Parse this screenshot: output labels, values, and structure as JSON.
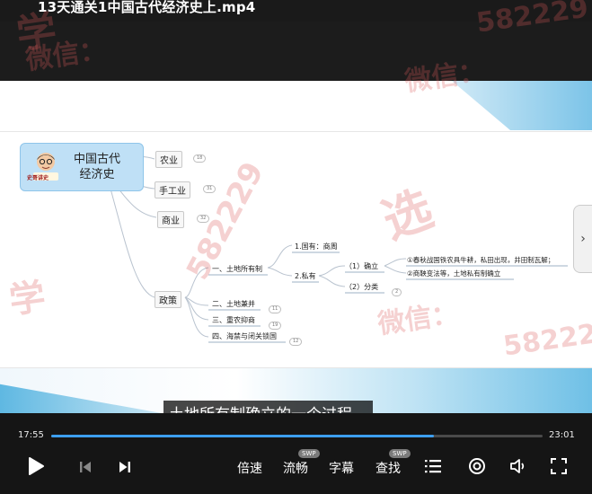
{
  "window": {
    "title": "13天通关1中国古代经济史上.mp4"
  },
  "mindmap": {
    "root": {
      "line1": "中国古代",
      "line2": "经济史",
      "avatar_caption": "史哥讲史"
    },
    "branches": [
      {
        "label": "农业",
        "badge": "18"
      },
      {
        "label": "手工业",
        "badge": "31"
      },
      {
        "label": "商业",
        "badge": "32"
      },
      {
        "label": "政策",
        "badge": ""
      }
    ],
    "policy_items": [
      {
        "label": "一、土地所有制"
      },
      {
        "label": "二、土地兼并",
        "badge": "11"
      },
      {
        "label": "三、重农抑商",
        "badge": "19"
      },
      {
        "label": "四、海禁与闭关锁国",
        "badge": "12"
      }
    ],
    "ownership": [
      {
        "label": "1.国有：商周"
      },
      {
        "label": "2.私有"
      }
    ],
    "private": [
      {
        "label": "（1）确立"
      },
      {
        "label": "（2）分类",
        "badge": "2"
      }
    ],
    "establish": [
      {
        "label": "①春秋战国铁农具牛耕，私田出现，井田制瓦解；"
      },
      {
        "label": "②商鞅变法等，土地私有制确立"
      }
    ]
  },
  "subtitle": "土地所有制确立的一个过程。",
  "player": {
    "current_time": "17:55",
    "total_time": "23:01",
    "progress": 0.779,
    "speed_label": "倍速",
    "smooth_label": "流畅",
    "smooth_badge": "SWP",
    "caption_label": "字幕",
    "find_label": "查找",
    "find_badge": "SWP"
  },
  "watermark": {
    "text1": "学",
    "text2": "微信：",
    "number": "582229",
    "text3": "选"
  },
  "icons": {
    "play": "play-icon",
    "prev": "skip-previous-icon",
    "next": "skip-next-icon",
    "list": "list-icon",
    "record": "target-icon",
    "volume": "volume-icon",
    "fullscreen": "fullscreen-icon",
    "nav_next": "chevron-right-icon"
  },
  "colors": {
    "accent": "#3d9ff0",
    "root_fill": "#bfe0f6"
  }
}
